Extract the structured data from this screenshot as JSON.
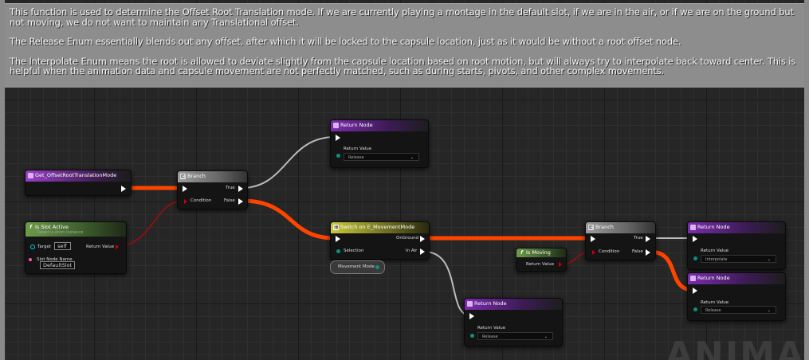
{
  "comment": {
    "p1": "This function is used to determine the Offset Root Translation mode. If we are currently playing a montage in the default slot, if we are in the air, or if we are on the ground but not moving, we do not want to maintain any Translational offset.",
    "p2": "The Release Enum essentially blends out any offset, after which it will be locked to the capsule location, just as it would be without a root offset node.",
    "p3": "The Interpolate Enum means the root is allowed to deviate slightly from the capsule location based on root motion, but will always try to interpolate back toward center. This is helpful when the animation data and capsule movement are not perfectly matched, such as during starts, pivots, and other complex movements."
  },
  "nodes": {
    "entry": {
      "title": "Get_OffsetRootTranslationMode"
    },
    "branch1": {
      "title": "Branch",
      "condition": "Condition",
      "true_label": "True",
      "false_label": "False"
    },
    "return_top": {
      "title": "Return Node",
      "value_label": "Return Value",
      "value": "Release"
    },
    "is_slot_active": {
      "title": "Is Slot Active",
      "subtitle": "Target is Anim Instance",
      "target_label": "Target",
      "target_value": "self",
      "return_label": "Return Value",
      "slot_label": "Slot Node Name",
      "slot_value": "DefaultSlot"
    },
    "switch": {
      "title": "Switch on E_MovementMode",
      "selection_label": "Selection",
      "on_ground": "OnGround",
      "in_air": "In Air"
    },
    "movement_mode": {
      "title": "Movement Mode"
    },
    "is_moving": {
      "title": "Is Moving",
      "return_label": "Return Value"
    },
    "branch2": {
      "title": "Branch",
      "condition": "Condition",
      "true_label": "True",
      "false_label": "False"
    },
    "return_interp": {
      "title": "Return Node",
      "value_label": "Return Value",
      "value": "Interpolate"
    },
    "return_release2": {
      "title": "Return Node",
      "value_label": "Return Value",
      "value": "Release"
    },
    "return_bottom": {
      "title": "Return Node",
      "value_label": "Return Value",
      "value": "Release"
    }
  },
  "watermark": "ANIMA",
  "colors": {
    "exec_wire_active": "#ff4400",
    "exec_wire": "#bbbbbb",
    "bool_wire": "#8a1010"
  }
}
